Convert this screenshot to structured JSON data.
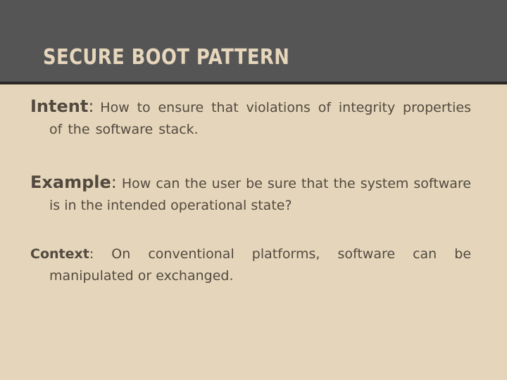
{
  "slide": {
    "title": "SECURE BOOT PATTERN",
    "colors": {
      "header_bg": "#555555",
      "header_rule": "#2b2825",
      "title_text": "#e6d6bc",
      "body_bg": "#e5d6bb",
      "body_text": "#524a3f"
    },
    "paragraphs": [
      {
        "label": "Intent",
        "separator": ":",
        "text": "How to ensure that violations of integrity properties of the software stack."
      },
      {
        "label": "Example",
        "separator": ":",
        "text": "How can the user be sure that the system software is in the intended operational state?"
      },
      {
        "label": "Context",
        "separator": ":",
        "text": "On conventional platforms, software can be manipulated or exchanged."
      }
    ]
  }
}
